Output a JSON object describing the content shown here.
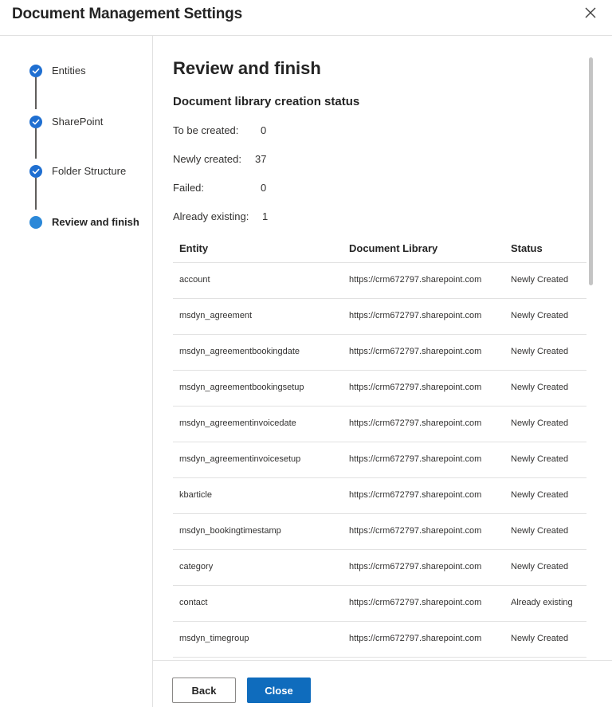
{
  "dialog": {
    "title": "Document Management Settings",
    "close_icon": "close-icon"
  },
  "steps": [
    {
      "label": "Entities",
      "state": "completed",
      "icon": "checkmark-icon"
    },
    {
      "label": "SharePoint",
      "state": "completed",
      "icon": "checkmark-icon"
    },
    {
      "label": "Folder Structure",
      "state": "completed",
      "icon": "checkmark-icon"
    },
    {
      "label": "Review and finish",
      "state": "current",
      "icon": "current-step-dot-icon"
    }
  ],
  "main": {
    "title": "Review and finish",
    "subtitle": "Document library creation status",
    "stats": [
      {
        "label": "To be created:",
        "value": "0"
      },
      {
        "label": "Newly created:",
        "value": "37"
      },
      {
        "label": "Failed:",
        "value": "0"
      },
      {
        "label": "Already existing:",
        "value": "1"
      }
    ]
  },
  "table": {
    "headers": [
      "Entity",
      "Document Library",
      "Status"
    ],
    "rows": [
      [
        "account",
        "https://crm672797.sharepoint.com",
        "Newly Created"
      ],
      [
        "msdyn_agreement",
        "https://crm672797.sharepoint.com",
        "Newly Created"
      ],
      [
        "msdyn_agreementbookingdate",
        "https://crm672797.sharepoint.com",
        "Newly Created"
      ],
      [
        "msdyn_agreementbookingsetup",
        "https://crm672797.sharepoint.com",
        "Newly Created"
      ],
      [
        "msdyn_agreementinvoicedate",
        "https://crm672797.sharepoint.com",
        "Newly Created"
      ],
      [
        "msdyn_agreementinvoicesetup",
        "https://crm672797.sharepoint.com",
        "Newly Created"
      ],
      [
        "kbarticle",
        "https://crm672797.sharepoint.com",
        "Newly Created"
      ],
      [
        "msdyn_bookingtimestamp",
        "https://crm672797.sharepoint.com",
        "Newly Created"
      ],
      [
        "category",
        "https://crm672797.sharepoint.com",
        "Newly Created"
      ],
      [
        "contact",
        "https://crm672797.sharepoint.com",
        "Already existing"
      ],
      [
        "msdyn_timegroup",
        "https://crm672797.sharepoint.com",
        "Newly Created"
      ]
    ]
  },
  "footer": {
    "back_label": "Back",
    "close_label": "Close"
  },
  "colors": {
    "accent": "#0f6cbd",
    "step_completed": "#1f6fd1",
    "step_current": "#2b88d8",
    "divider": "#e1e1e1"
  }
}
